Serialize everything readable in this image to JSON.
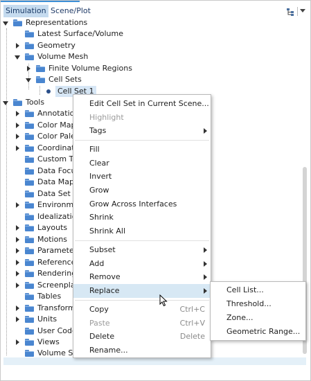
{
  "header": {
    "tabs": [
      {
        "label": "Simulation"
      },
      {
        "label": "Scene/Plot"
      }
    ]
  },
  "tree": {
    "items": [
      {
        "label": "Representations"
      },
      {
        "label": "Latest Surface/Volume"
      },
      {
        "label": "Geometry"
      },
      {
        "label": "Volume Mesh"
      },
      {
        "label": "Finite Volume Regions"
      },
      {
        "label": "Cell Sets"
      },
      {
        "label": "Cell Set 1"
      },
      {
        "label": "Tools"
      },
      {
        "label": "Annotatio"
      },
      {
        "label": "Color Map"
      },
      {
        "label": "Color Pale"
      },
      {
        "label": "Coordinat"
      },
      {
        "label": "Custom Tr"
      },
      {
        "label": "Data Focu"
      },
      {
        "label": "Data Map"
      },
      {
        "label": "Data Set F"
      },
      {
        "label": "Environm"
      },
      {
        "label": "Idealizatio"
      },
      {
        "label": "Layouts"
      },
      {
        "label": "Motions"
      },
      {
        "label": "Paramete"
      },
      {
        "label": "Reference"
      },
      {
        "label": "Rendering"
      },
      {
        "label": "Screenpla"
      },
      {
        "label": "Tables"
      },
      {
        "label": "Transform"
      },
      {
        "label": "Units"
      },
      {
        "label": "User Code"
      },
      {
        "label": "Views"
      },
      {
        "label": "Volume Sh"
      }
    ]
  },
  "context_menu": {
    "items": [
      {
        "label": "Edit Cell Set in Current Scene..."
      },
      {
        "label": "Highlight"
      },
      {
        "label": "Tags"
      },
      {
        "label": "Fill"
      },
      {
        "label": "Clear"
      },
      {
        "label": "Invert"
      },
      {
        "label": "Grow"
      },
      {
        "label": "Grow Across Interfaces"
      },
      {
        "label": "Shrink"
      },
      {
        "label": "Shrink All"
      },
      {
        "label": "Subset"
      },
      {
        "label": "Add"
      },
      {
        "label": "Remove"
      },
      {
        "label": "Replace"
      },
      {
        "label": "Copy",
        "shortcut": "Ctrl+C"
      },
      {
        "label": "Paste",
        "shortcut": "Ctrl+V"
      },
      {
        "label": "Delete",
        "shortcut": "Delete"
      },
      {
        "label": "Rename..."
      }
    ]
  },
  "submenu": {
    "items": [
      {
        "label": "Cell List..."
      },
      {
        "label": "Threshold..."
      },
      {
        "label": "Zone..."
      },
      {
        "label": "Geometric Range..."
      }
    ]
  },
  "colors": {
    "accent": "#3c8fd6",
    "selection": "#c5dbef",
    "menu_hover": "#d7e8f4",
    "folder": "#4a86d0"
  },
  "icons": [
    "tree-layout-icon",
    "chevron-down-icon",
    "folder-icon",
    "expand-arrow-icon",
    "collapse-arrow-icon",
    "submenu-arrow-icon",
    "cell-set-dot-icon",
    "mouse-cursor-icon"
  ]
}
